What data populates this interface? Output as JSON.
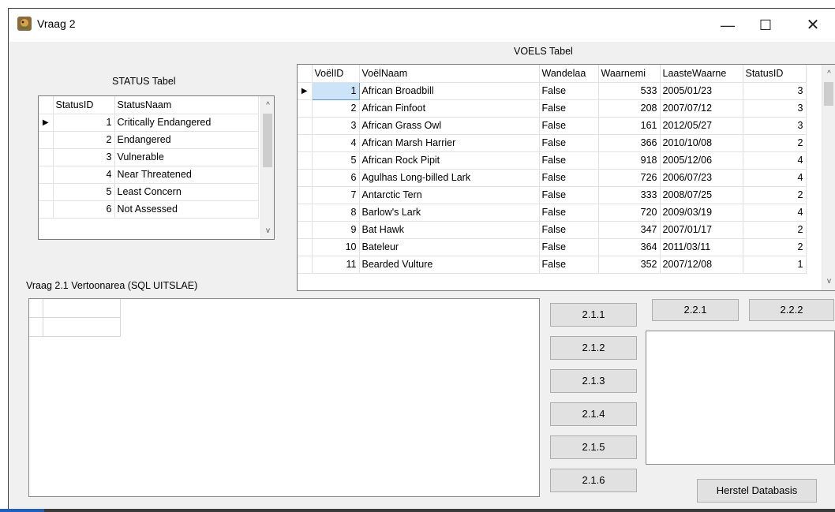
{
  "window": {
    "title": "Vraag 2",
    "icon": "bird-app-icon",
    "minimize_glyph": "—",
    "maximize_glyph": "☐",
    "close_glyph": "✕"
  },
  "status_table": {
    "caption": "STATUS Tabel",
    "columns": [
      "StatusID",
      "StatusNaam"
    ],
    "rows": [
      {
        "id": "1",
        "name": "Critically Endangered"
      },
      {
        "id": "2",
        "name": "Endangered"
      },
      {
        "id": "3",
        "name": "Vulnerable"
      },
      {
        "id": "4",
        "name": "Near Threatened"
      },
      {
        "id": "5",
        "name": "Least Concern"
      },
      {
        "id": "6",
        "name": "Not Assessed"
      }
    ]
  },
  "voels_table": {
    "caption": "VOELS Tabel",
    "columns": [
      "VoëlID",
      "VoëlNaam",
      "Wandelaa",
      "Waarnemi",
      "LaasteWaarne",
      "StatusID"
    ],
    "rows": [
      {
        "id": "1",
        "name": "African Broadbill",
        "wandel": "False",
        "waarn": "533",
        "date": "2005/01/23",
        "status": "3"
      },
      {
        "id": "2",
        "name": "African Finfoot",
        "wandel": "False",
        "waarn": "208",
        "date": "2007/07/12",
        "status": "3"
      },
      {
        "id": "3",
        "name": "African Grass Owl",
        "wandel": "False",
        "waarn": "161",
        "date": "2012/05/27",
        "status": "3"
      },
      {
        "id": "4",
        "name": "African Marsh Harrier",
        "wandel": "False",
        "waarn": "366",
        "date": "2010/10/08",
        "status": "2"
      },
      {
        "id": "5",
        "name": "African Rock Pipit",
        "wandel": "False",
        "waarn": "918",
        "date": "2005/12/06",
        "status": "4"
      },
      {
        "id": "6",
        "name": "Agulhas Long-billed Lark",
        "wandel": "False",
        "waarn": "726",
        "date": "2006/07/23",
        "status": "4"
      },
      {
        "id": "7",
        "name": "Antarctic Tern",
        "wandel": "False",
        "waarn": "333",
        "date": "2008/07/25",
        "status": "2"
      },
      {
        "id": "8",
        "name": "Barlow's Lark",
        "wandel": "False",
        "waarn": "720",
        "date": "2009/03/19",
        "status": "4"
      },
      {
        "id": "9",
        "name": "Bat Hawk",
        "wandel": "False",
        "waarn": "347",
        "date": "2007/01/17",
        "status": "2"
      },
      {
        "id": "10",
        "name": "Bateleur",
        "wandel": "False",
        "waarn": "364",
        "date": "2011/03/11",
        "status": "2"
      },
      {
        "id": "11",
        "name": "Bearded Vulture",
        "wandel": "False",
        "waarn": "352",
        "date": "2007/12/08",
        "status": "1"
      }
    ]
  },
  "display_area": {
    "caption": "Vraag 2.1  Vertoonarea (SQL UITSLAE)"
  },
  "buttons": {
    "b211": "2.1.1",
    "b212": "2.1.2",
    "b213": "2.1.3",
    "b214": "2.1.4",
    "b215": "2.1.5",
    "b216": "2.1.6",
    "b221": "2.2.1",
    "b222": "2.2.2",
    "restore": "Herstel Databasis"
  },
  "icons": {
    "row_indicator": "▶",
    "scroll_up": "^",
    "scroll_down": "v"
  }
}
